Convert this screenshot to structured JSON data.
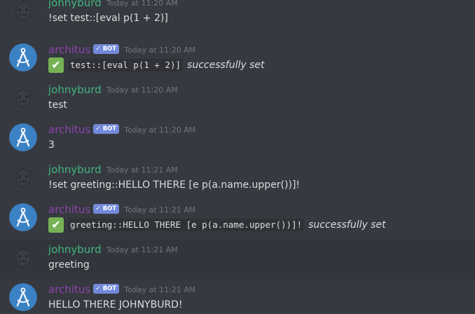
{
  "messages": [
    {
      "username": "johnyburd",
      "timestamp": "Today at 11:20 AM",
      "text": "!set test::[eval p(1 + 2)]"
    },
    {
      "username": "architus",
      "bot_tag": "BOT",
      "timestamp": "Today at 11:20 AM",
      "emoji": "✔",
      "code": "test::[eval p(1 + 2)]",
      "suffix": "successfully set"
    },
    {
      "username": "johnyburd",
      "timestamp": "Today at 11:20 AM",
      "text": "test"
    },
    {
      "username": "architus",
      "bot_tag": "BOT",
      "timestamp": "Today at 11:20 AM",
      "text": "3"
    },
    {
      "username": "johnyburd",
      "timestamp": "Today at 11:21 AM",
      "text": "!set greeting::HELLO THERE [e p(a.name.upper())]!"
    },
    {
      "username": "architus",
      "bot_tag": "BOT",
      "timestamp": "Today at 11:21 AM",
      "emoji": "✔",
      "code": "greeting::HELLO THERE [e p(a.name.upper())]!",
      "suffix": "successfully set"
    },
    {
      "username": "johnyburd",
      "timestamp": "Today at 11:21 AM",
      "text": "greeting"
    },
    {
      "username": "architus",
      "bot_tag": "BOT",
      "timestamp": "Today at 11:21 AM",
      "text": "HELLO THERE JOHNYBURD!"
    }
  ],
  "colors": {
    "background": "#36393f",
    "hover_background": "#32353b",
    "human_username": "#43b581",
    "bot_username": "#8e44ad",
    "bot_tag": "#7289da",
    "timestamp": "#72767d",
    "text": "#dcddde",
    "code_background": "#2f3136",
    "check_emoji": "#77b255"
  },
  "icons": {
    "human_avatar": "robot-face-icon",
    "bot_avatar": "compass-icon",
    "bot_tag_check": "checkmark-icon",
    "success_emoji": "white-check-mark-icon"
  }
}
